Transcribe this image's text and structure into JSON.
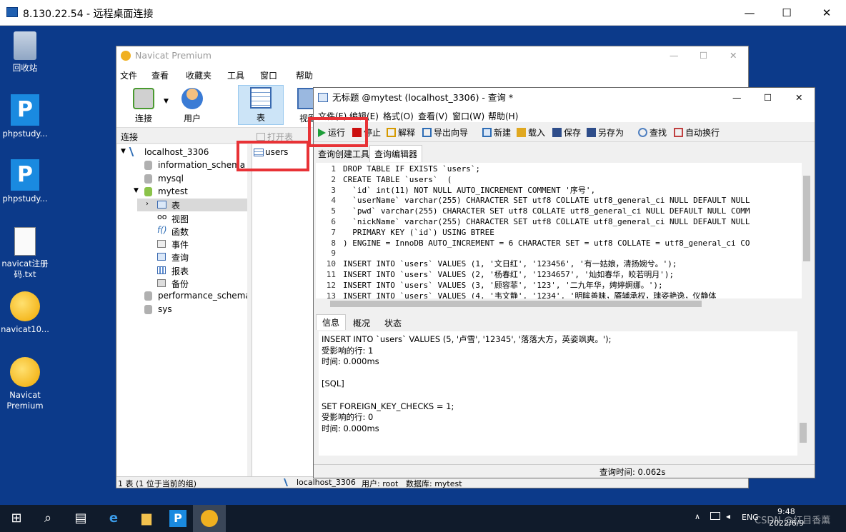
{
  "rdp": {
    "title": "8.130.22.54 - 远程桌面连接",
    "controls": [
      "—",
      "☐",
      "✕"
    ]
  },
  "desktop": {
    "icons": [
      {
        "label": "回收站",
        "icon": "recycle-bin-icon"
      },
      {
        "label": "phpstudy...",
        "icon": "phpstudy-icon"
      },
      {
        "label": "phpstudy...",
        "icon": "phpstudy-icon"
      },
      {
        "label": "navicat注册码.txt",
        "icon": "text-file-icon"
      },
      {
        "label": "navicat10...",
        "icon": "navicat-icon"
      },
      {
        "label": "Navicat Premium",
        "icon": "navicat-icon"
      }
    ]
  },
  "navicat": {
    "title": "Navicat Premium",
    "menu": [
      "文件",
      "查看",
      "收藏夹",
      "工具",
      "窗口",
      "帮助"
    ],
    "toolbar": [
      {
        "label": "连接",
        "icon": "connection-icon"
      },
      {
        "label": "用户",
        "icon": "user-icon"
      },
      {
        "label": "表",
        "icon": "table-icon"
      },
      {
        "label": "视图",
        "icon": "view-icon"
      }
    ],
    "connection_header": "连接",
    "open_table": "打开表",
    "tree": [
      {
        "label": "localhost_3306",
        "icon": "connection-icon"
      },
      {
        "label": "information_schema",
        "icon": "database-icon"
      },
      {
        "label": "mysql",
        "icon": "database-icon"
      },
      {
        "label": "mytest",
        "icon": "database-icon"
      },
      {
        "label": "表",
        "icon": "table-icon"
      },
      {
        "label": "视图",
        "icon": "view-icon"
      },
      {
        "label": "函数",
        "icon": "function-icon"
      },
      {
        "label": "事件",
        "icon": "event-icon"
      },
      {
        "label": "查询",
        "icon": "query-icon"
      },
      {
        "label": "报表",
        "icon": "report-icon"
      },
      {
        "label": "备份",
        "icon": "backup-icon"
      },
      {
        "label": "performance_schema",
        "icon": "database-icon"
      },
      {
        "label": "sys",
        "icon": "database-icon"
      }
    ],
    "table_item": "users",
    "status_left": "1 表 (1 位于当前的组)",
    "status_conn": "localhost_3306",
    "status_user": "用户: root",
    "status_db": "数据库: mytest"
  },
  "query": {
    "title": "无标题 @mytest (localhost_3306) - 查询 *",
    "controls": [
      "—",
      "☐",
      "✕"
    ],
    "menu": [
      "文件(F)",
      "编辑(E)",
      "格式(O)",
      "查看(V)",
      "窗口(W)",
      "帮助(H)"
    ],
    "toolbar": [
      {
        "label": "运行",
        "icon": "run-icon",
        "color": "#1e9e3a"
      },
      {
        "label": "停止",
        "icon": "stop-icon",
        "color": "#cc1010"
      },
      {
        "label": "解释",
        "icon": "explain-icon",
        "color": "#d69a00"
      },
      {
        "label": "导出向导",
        "icon": "export-icon",
        "color": "#2e6db5"
      },
      {
        "label": "新建",
        "icon": "new-icon",
        "color": "#2e6db5"
      },
      {
        "label": "载入",
        "icon": "load-icon",
        "color": "#e0a820"
      },
      {
        "label": "保存",
        "icon": "save-icon",
        "color": "#2e4d8a"
      },
      {
        "label": "另存为",
        "icon": "save-as-icon",
        "color": "#2e4d8a"
      },
      {
        "label": "查找",
        "icon": "search-icon",
        "color": "#5080c0"
      },
      {
        "label": "自动换行",
        "icon": "wrap-icon",
        "color": "#c04040"
      }
    ],
    "tabs": [
      "查询创建工具",
      "查询编辑器"
    ],
    "code_lines": [
      {
        "n": "1",
        "text": "DROP TABLE IF EXISTS `users`;"
      },
      {
        "n": "2",
        "text": "CREATE TABLE `users`  ("
      },
      {
        "n": "3",
        "text": "  `id` int(11) NOT NULL AUTO_INCREMENT COMMENT '序号',"
      },
      {
        "n": "4",
        "text": "  `userName` varchar(255) CHARACTER SET utf8 COLLATE utf8_general_ci NULL DEFAULT NULL"
      },
      {
        "n": "5",
        "text": "  `pwd` varchar(255) CHARACTER SET utf8 COLLATE utf8_general_ci NULL DEFAULT NULL COMM"
      },
      {
        "n": "6",
        "text": "  `nickName` varchar(255) CHARACTER SET utf8 COLLATE utf8_general_ci NULL DEFAULT NULL"
      },
      {
        "n": "7",
        "text": "  PRIMARY KEY (`id`) USING BTREE"
      },
      {
        "n": "8",
        "text": ") ENGINE = InnoDB AUTO_INCREMENT = 6 CHARACTER SET = utf8 COLLATE = utf8_general_ci CO"
      },
      {
        "n": "9",
        "text": ""
      },
      {
        "n": "10",
        "text": "INSERT INTO `users` VALUES (1, '文日红', '123456', '有一姑娘，清扬婉兮。');"
      },
      {
        "n": "11",
        "text": "INSERT INTO `users` VALUES (2, '杨春红', '1234657', '灿如春华，皎若明月');"
      },
      {
        "n": "12",
        "text": "INSERT INTO `users` VALUES (3, '顾容菲', '123', '二九年华，娉婷婀娜。');"
      },
      {
        "n": "13",
        "text": "INSERT INTO `users` VALUES (4, '韦文静', '1234', '明眸善睐，靥辅承权，瑰姿艳逸，仪静体"
      }
    ],
    "result_tabs": [
      "信息",
      "概况",
      "状态"
    ],
    "messages": [
      "INSERT INTO `users` VALUES (5, '卢雪', '12345', '落落大方，英姿飒爽。');",
      "受影响的行: 1",
      "时间: 0.000ms",
      "",
      "[SQL]",
      "",
      "SET FOREIGN_KEY_CHECKS = 1;",
      "受影响的行: 0",
      "时间: 0.000ms"
    ],
    "status_time": "查询时间: 0.062s"
  },
  "taskbar": {
    "lang": "ENG",
    "time": "9:48",
    "date": "2022/6/9",
    "watermark": "CSDN @红目香薰"
  }
}
